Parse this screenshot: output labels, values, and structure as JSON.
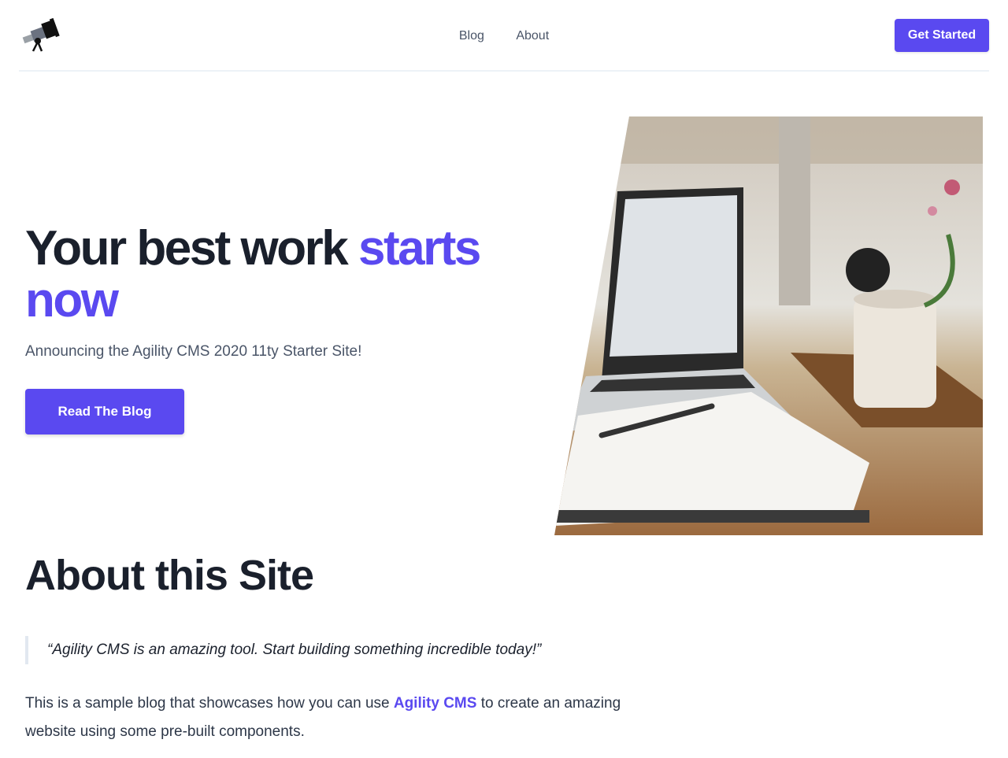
{
  "header": {
    "nav": [
      "Blog",
      "About"
    ],
    "cta_label": "Get Started"
  },
  "hero": {
    "title_part1": "Your best work ",
    "title_accent": "starts now",
    "subtitle": "Announcing the Agility CMS 2020 11ty Starter Site!",
    "button_label": "Read The Blog"
  },
  "about": {
    "title": "About this Site",
    "quote": "“Agility CMS is an amazing tool.  Start building something incredible today!”",
    "body_before": "This is a sample blog that showcases how you can use ",
    "body_link": "Agility CMS",
    "body_after": " to create an amazing website using some pre-built components."
  },
  "colors": {
    "accent": "#5a49f0",
    "heading": "#1a202c",
    "muted": "#4a5568"
  },
  "icons": [
    "telescope-logo-icon"
  ]
}
